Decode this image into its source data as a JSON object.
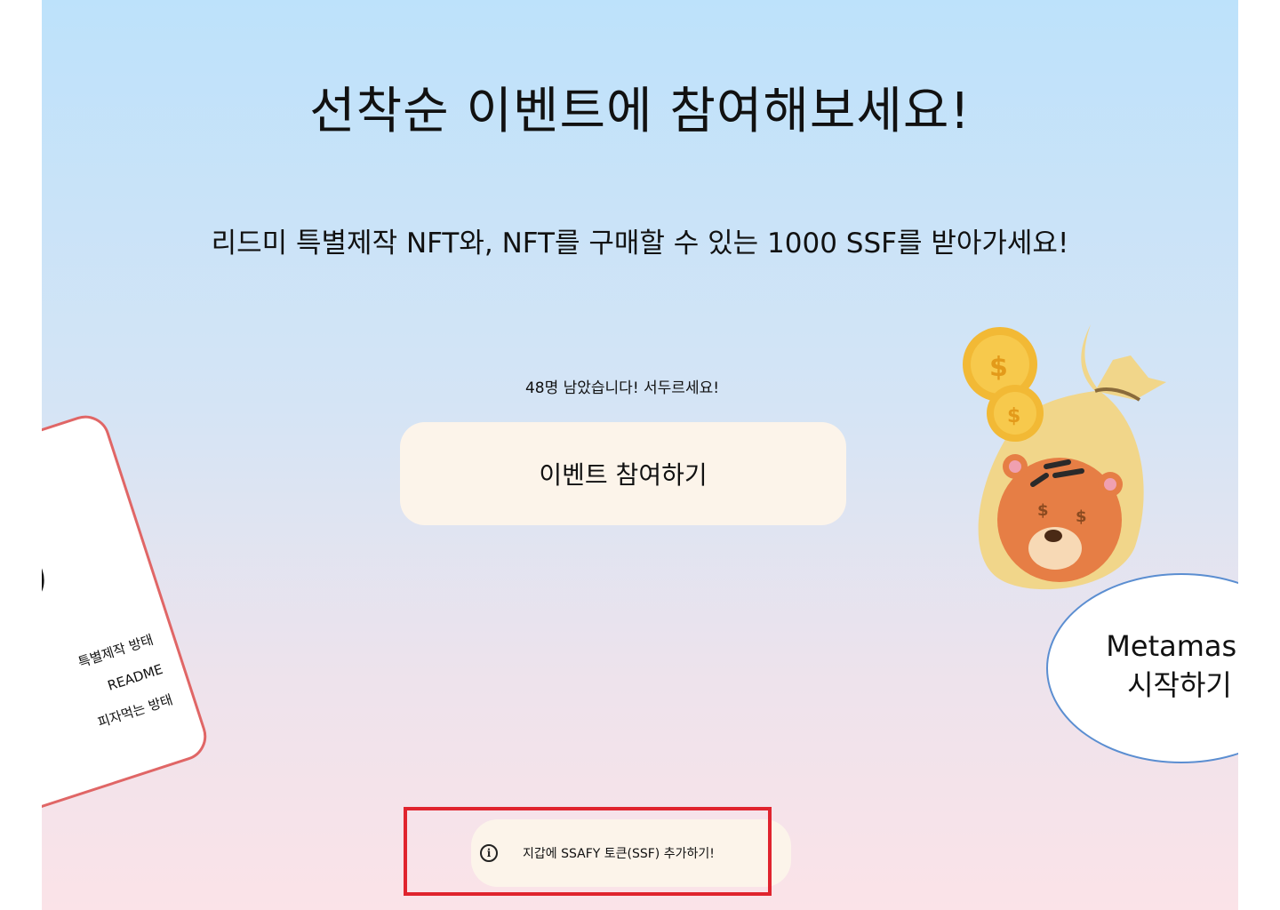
{
  "hero": {
    "title": "선착순 이벤트에 참여해보세요!",
    "subtitle": "리드미 특별제작 NFT와, NFT를 구매할 수 있는 1000 SSF를 받아가세요!"
  },
  "event": {
    "remaining_text": "48명 남았습니다! 서두르세요!",
    "join_button_label": "이벤트 참여하기"
  },
  "card": {
    "menu_items": [
      "특별제작 방태",
      "README",
      "피자먹는 방태"
    ]
  },
  "metamask": {
    "line1": "Metamask",
    "line2": "시작하기"
  },
  "token": {
    "add_label": "지갑에 SSAFY 토큰(SSF) 추가하기!",
    "icon": "info-icon"
  },
  "colors": {
    "button_bg": "#fcf4ea",
    "highlight": "#e0242e",
    "card_border": "#e06666",
    "bubble_border": "#5b8ed1"
  }
}
